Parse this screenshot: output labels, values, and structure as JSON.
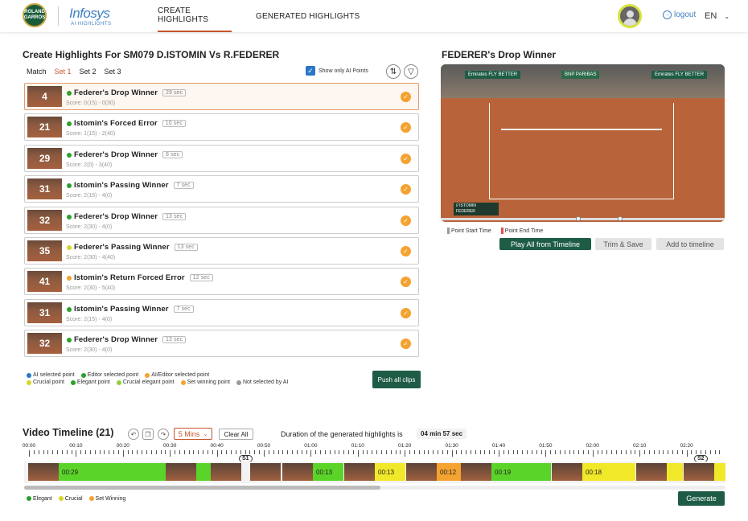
{
  "header": {
    "brand_mark": "ROLAND GARROS",
    "logo": "Infosys",
    "logo_sub": "AI HIGHLIGHTS",
    "nav": [
      "CREATE HIGHLIGHTS",
      "GENERATED HIGHLIGHTS"
    ],
    "logout": "logout",
    "lang": "EN"
  },
  "left": {
    "title": "Create Highlights For SM079 D.ISTOMIN Vs R.FEDERER",
    "tabs": [
      "Match",
      "Set 1",
      "Set 2",
      "Set 3"
    ],
    "show_ai_label": "Show only AI Points",
    "items": [
      {
        "num": "4",
        "name": "Federer's Drop Winner",
        "dur": "29 sec",
        "score": "Score: 0(15) - 0(30)",
        "dot": "#2aa12a"
      },
      {
        "num": "21",
        "name": "Istomin's Forced Error",
        "dur": "10 sec",
        "score": "Score: 1(15) - 2(40)",
        "dot": "#2aa12a"
      },
      {
        "num": "29",
        "name": "Federer's Drop Winner",
        "dur": "8 sec",
        "score": "Score: 2(0) - 3(40)",
        "dot": "#2aa12a"
      },
      {
        "num": "31",
        "name": "Istomin's Passing Winner",
        "dur": "7 sec",
        "score": "Score: 2(15) - 4(0)",
        "dot": "#2aa12a"
      },
      {
        "num": "32",
        "name": "Federer's Drop Winner",
        "dur": "13 sec",
        "score": "Score: 2(30) - 4(0)",
        "dot": "#2aa12a"
      },
      {
        "num": "35",
        "name": "Federer's Passing Winner",
        "dur": "13 sec",
        "score": "Score: 2(30) - 4(40)",
        "dot": "#d6d62a"
      },
      {
        "num": "41",
        "name": "Istomin's Return Forced Error",
        "dur": "12 sec",
        "score": "Score: 2(30) - 5(40)",
        "dot": "#f4a230"
      },
      {
        "num": "31",
        "name": "Istomin's Passing Winner",
        "dur": "7 sec",
        "score": "Score: 2(15) - 4(0)",
        "dot": "#2aa12a"
      },
      {
        "num": "32",
        "name": "Federer's Drop Winner",
        "dur": "13 sec",
        "score": "Score: 2(30) - 4(0)",
        "dot": "#2aa12a"
      }
    ],
    "legend_row1": [
      {
        "label": "AI selected point",
        "color": "#2a77c9"
      },
      {
        "label": "Editor selected point",
        "color": "#2aa12a"
      },
      {
        "label": "AI/Editor selected point",
        "color": "#f4a230"
      }
    ],
    "legend_row2": [
      {
        "label": "Crucial point",
        "color": "#d6d62a"
      },
      {
        "label": "Elegant point",
        "color": "#2aa12a"
      },
      {
        "label": "Crucial elegant point",
        "color": "#8fcf3a"
      },
      {
        "label": "Set winning point",
        "color": "#f4a230"
      },
      {
        "label": "Not selected by AI",
        "color": "#999999"
      }
    ],
    "push_label": "Push all clips"
  },
  "right": {
    "title": "FEDERER's Drop Winner",
    "banner1": "Emirates FLY BETTER",
    "banner2": "BNP PARIBAS",
    "banner3": "Emirates FLY BETTER",
    "score_p1": "// ISTOMIN",
    "score_p2": "FEDERER",
    "start_label": "Point Start Time",
    "end_label": "Point End Time",
    "play_label": "Play All from Timeline",
    "trim_label": "Trim & Save",
    "add_label": "Add to timeline"
  },
  "timeline": {
    "title": "Video Timeline (21)",
    "mins": "5 Mins",
    "clear": "Clear All",
    "duration_text": "Duration of the generated highlights is",
    "duration_value": "04 min 57 sec",
    "ticks": [
      "00:00",
      "00:10",
      "00:20",
      "00:30",
      "00:40",
      "00:50",
      "01:00",
      "01:10",
      "01:20",
      "01:30",
      "01:40",
      "01:50",
      "02:00",
      "02:10",
      "02:20"
    ],
    "marker1": "S1",
    "marker2": "S2",
    "seg_labels": [
      "00:29",
      "00:13",
      "00:13",
      "00:12",
      "00:19",
      "00:18"
    ],
    "legend": [
      {
        "label": "Elegant",
        "color": "#2aa12a"
      },
      {
        "label": "Crucial",
        "color": "#d6d62a"
      },
      {
        "label": "Set Winning",
        "color": "#f4a230"
      }
    ],
    "generate": "Generate"
  }
}
